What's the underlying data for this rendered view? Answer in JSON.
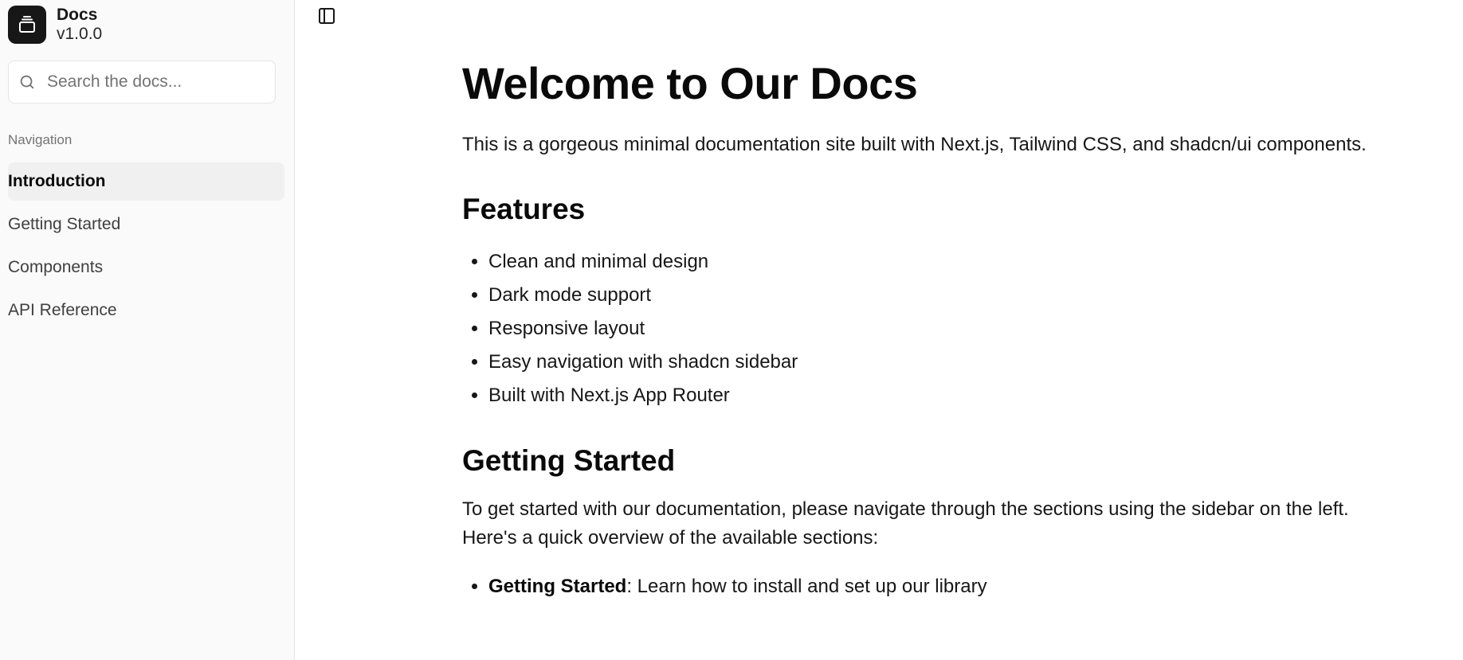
{
  "brand": {
    "name": "Docs",
    "version": "v1.0.0",
    "icon": "stack-icon"
  },
  "search": {
    "placeholder": "Search the docs...",
    "value": ""
  },
  "nav": {
    "group_label": "Navigation",
    "items": [
      {
        "label": "Introduction",
        "active": true
      },
      {
        "label": "Getting Started",
        "active": false
      },
      {
        "label": "Components",
        "active": false
      },
      {
        "label": "API Reference",
        "active": false
      }
    ]
  },
  "main": {
    "toggle_icon": "sidebar-toggle-icon",
    "title": "Welcome to Our Docs",
    "intro": "This is a gorgeous minimal documentation site built with Next.js, Tailwind CSS, and shadcn/ui components.",
    "features_heading": "Features",
    "features": [
      "Clean and minimal design",
      "Dark mode support",
      "Responsive layout",
      "Easy navigation with shadcn sidebar",
      "Built with Next.js App Router"
    ],
    "getting_started_heading": "Getting Started",
    "getting_started_text": "To get started with our documentation, please navigate through the sections using the sidebar on the left. Here's a quick overview of the available sections:",
    "sections": [
      {
        "name": "Getting Started",
        "description": ": Learn how to install and set up our library"
      }
    ]
  },
  "colors": {
    "sidebar_bg": "#fafafa",
    "active_item_bg": "#f0f0f0",
    "logo_bg": "#171717",
    "text": "#0a0a0a"
  }
}
